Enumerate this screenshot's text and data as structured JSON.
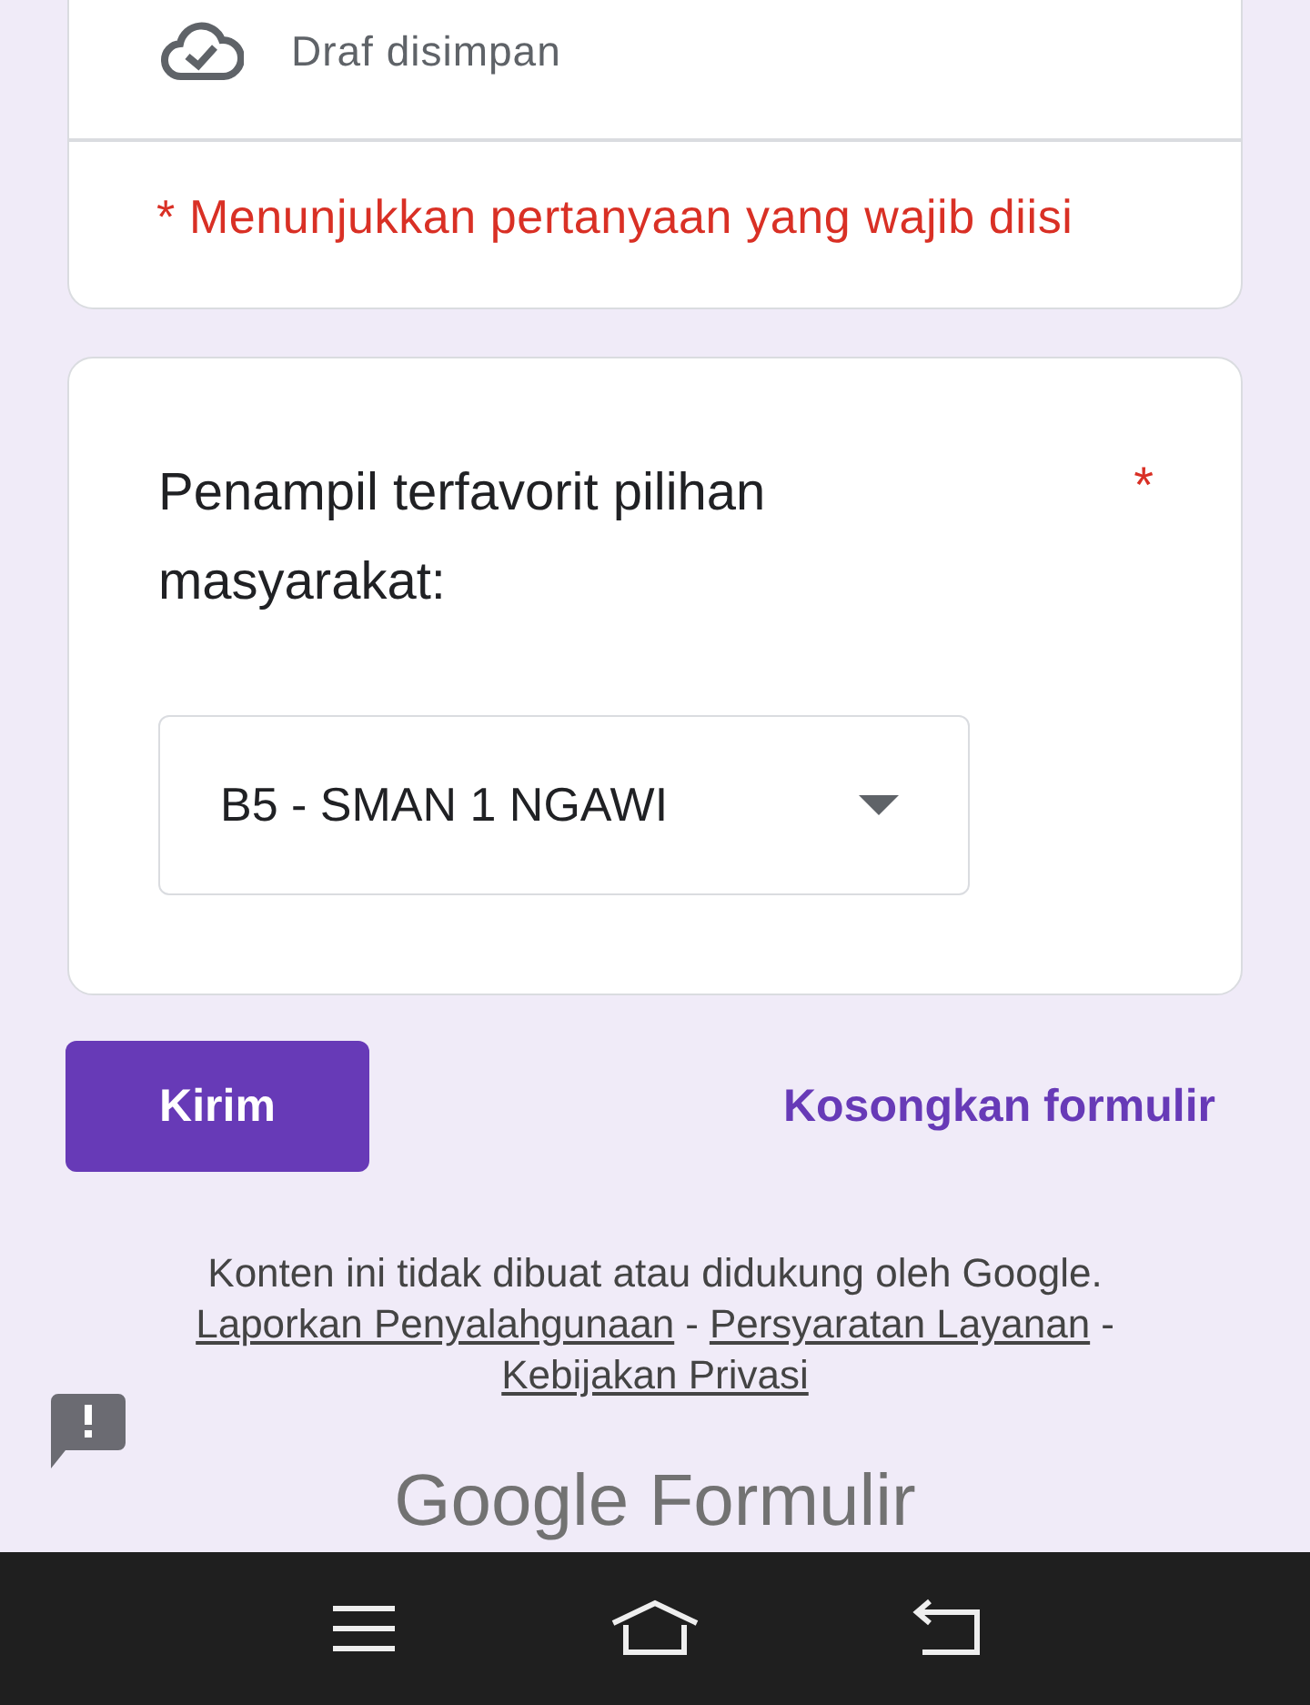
{
  "status_card": {
    "save_status": "Draf disimpan",
    "required_note": "* Menunjukkan pertanyaan yang wajib diisi"
  },
  "question": {
    "title": "Penampil terfavorit pilihan masyarakat:",
    "required_mark": "*",
    "dropdown": {
      "value": "B5 - SMAN 1 NGAWI"
    }
  },
  "actions": {
    "submit": "Kirim",
    "clear": "Kosongkan formulir"
  },
  "footer": {
    "disclaimer": "Konten ini tidak dibuat atau didukung oleh Google.",
    "links": [
      {
        "label": "Laporkan Penyalahgunaan"
      },
      {
        "label": "Persyaratan Layanan"
      },
      {
        "label": "Kebijakan Privasi"
      }
    ],
    "separator": "-",
    "brand": "Google Formulir"
  }
}
